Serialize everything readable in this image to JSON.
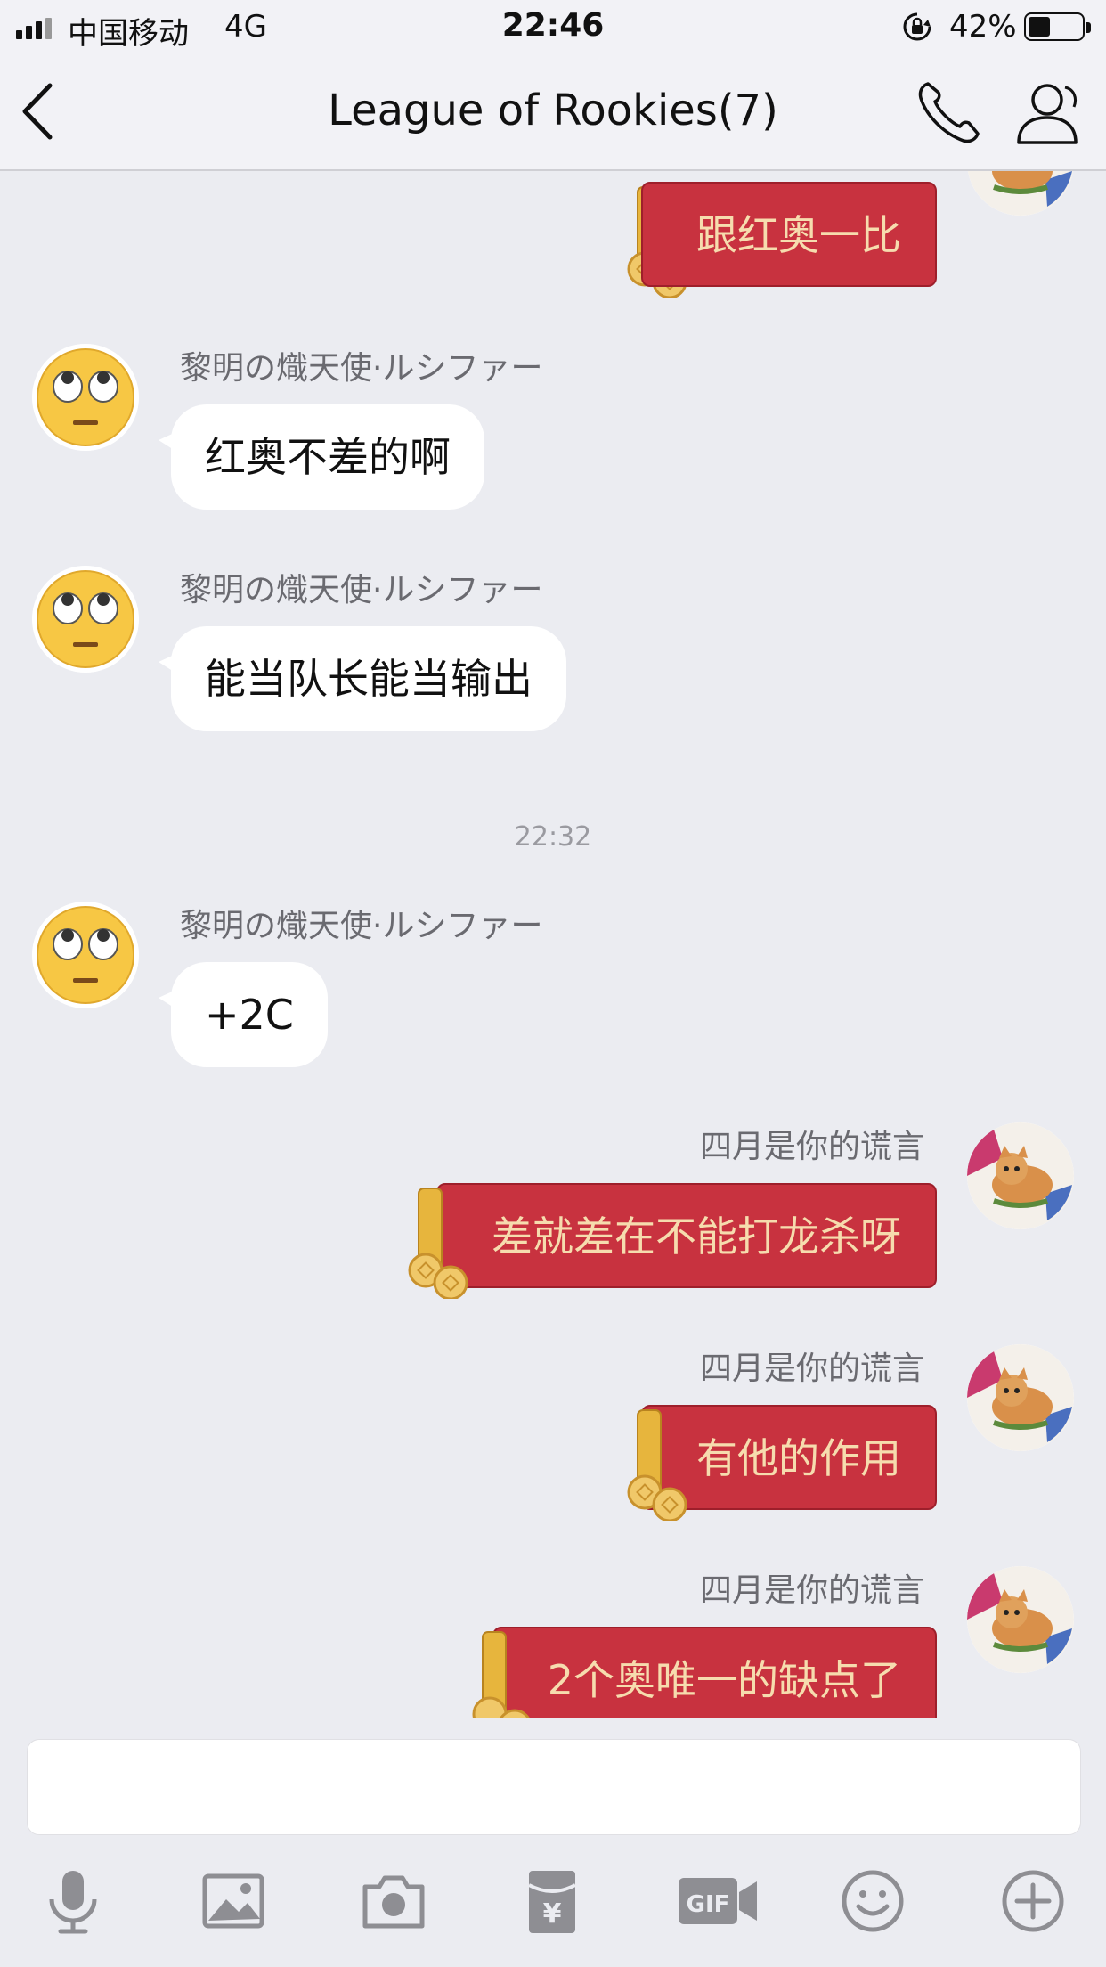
{
  "status_bar": {
    "carrier": "中国移动",
    "network": "4G",
    "time": "22:46",
    "battery": "42%",
    "battery_level": 0.42,
    "icons": [
      "signal-icon",
      "orientation-lock-icon",
      "battery-icon"
    ]
  },
  "nav": {
    "title": "League of Rookies(7)",
    "icons": [
      "back-icon",
      "phone-icon",
      "group-members-icon"
    ]
  },
  "messages": [
    {
      "direction": "out",
      "sender": "",
      "text": "跟红奥一比",
      "style": "red-scroll",
      "avatar": "cat-avatar"
    },
    {
      "direction": "in",
      "sender": "黎明の熾天使·ルシファー",
      "text": "红奥不差的啊",
      "avatar": "eye-roll-emoji-avatar"
    },
    {
      "direction": "in",
      "sender": "黎明の熾天使·ルシファー",
      "text": "能当队长能当输出",
      "avatar": "eye-roll-emoji-avatar"
    },
    {
      "type": "time",
      "text": "22:32"
    },
    {
      "direction": "in",
      "sender": "黎明の熾天使·ルシファー",
      "text": "+2C",
      "avatar": "eye-roll-emoji-avatar"
    },
    {
      "direction": "out",
      "sender": "四月是你的谎言",
      "text": "差就差在不能打龙杀呀",
      "style": "red-scroll",
      "avatar": "cat-avatar"
    },
    {
      "direction": "out",
      "sender": "四月是你的谎言",
      "text": "有他的作用",
      "style": "red-scroll",
      "avatar": "cat-avatar"
    },
    {
      "direction": "out",
      "sender": "四月是你的谎言",
      "text": "2个奥唯一的缺点了",
      "style": "red-scroll",
      "avatar": "cat-avatar"
    }
  ],
  "input": {
    "value": "",
    "placeholder": ""
  },
  "toolbar": [
    "microphone-icon",
    "image-icon",
    "camera-icon",
    "red-packet-icon",
    "gif-icon",
    "emoji-icon",
    "plus-icon"
  ],
  "colors": {
    "background": "#ebecf1",
    "bubble_in": "#ffffff",
    "bubble_red": "#c8323f",
    "bubble_red_text": "#f6dcae",
    "icon_gray": "#8e8e93"
  }
}
